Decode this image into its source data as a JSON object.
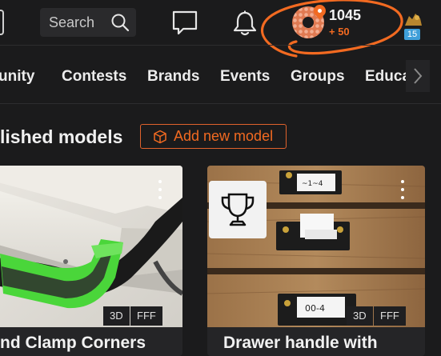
{
  "header": {
    "search_placeholder": "Search",
    "points": "1045",
    "points_delta": "+ 50",
    "level": "15",
    "accent": "#f26a21"
  },
  "nav": {
    "items": [
      "unity",
      "Contests",
      "Brands",
      "Events",
      "Groups",
      "Educa"
    ]
  },
  "section": {
    "title": "lished models",
    "add_button_label": "Add new model"
  },
  "cards": [
    {
      "title": "nd Clamp Corners",
      "tags": [
        "3D",
        "FFF"
      ]
    },
    {
      "title": "Drawer handle with",
      "tags": [
        "3D",
        "FFF"
      ],
      "award_icon": "trophy-icon"
    }
  ],
  "icons": {
    "search": "search-icon",
    "chat": "chat-icon",
    "bell": "bell-icon",
    "scroll": "chevron-right-icon",
    "add": "cube-icon",
    "menu": "kebab-menu-icon"
  }
}
